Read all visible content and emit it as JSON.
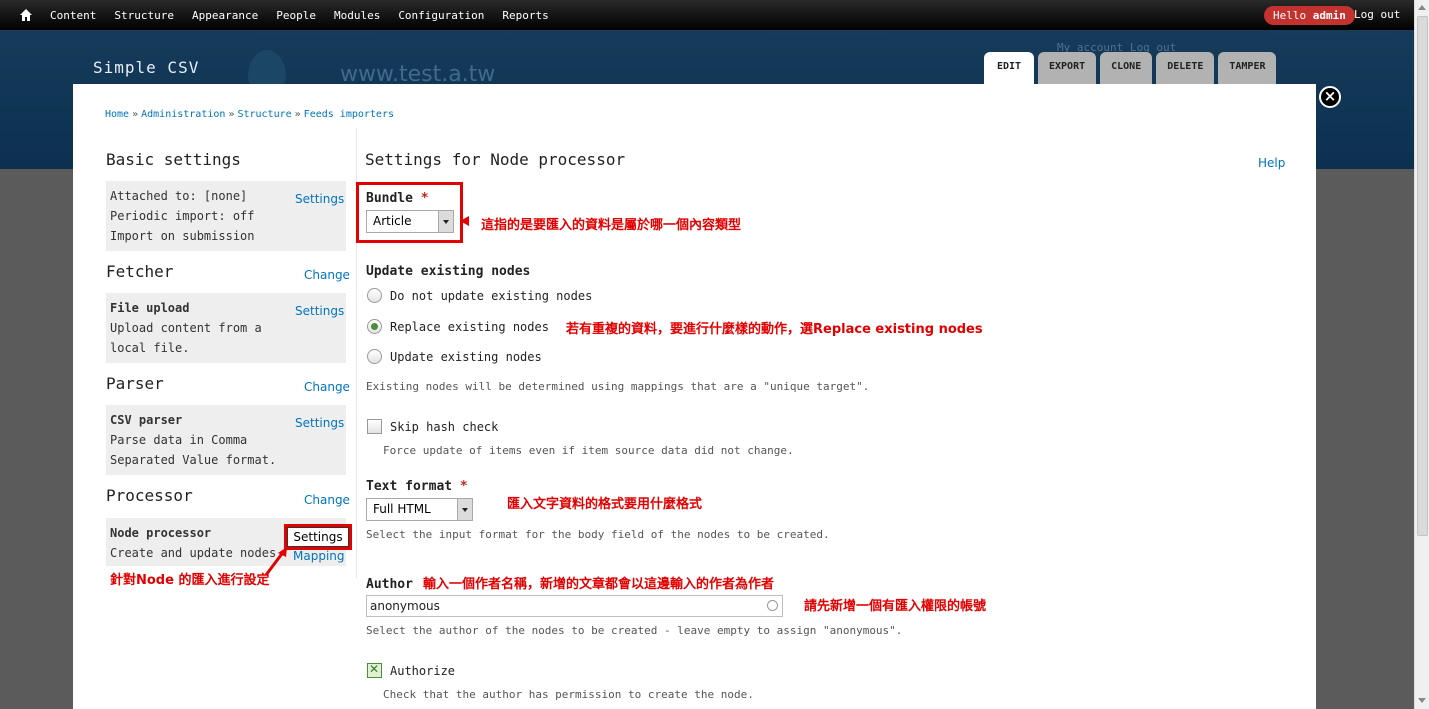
{
  "toolbar": {
    "items": [
      "Content",
      "Structure",
      "Appearance",
      "People",
      "Modules",
      "Configuration",
      "Reports"
    ],
    "hello_prefix": "Hello ",
    "hello_user": "admin",
    "logout": "Log out"
  },
  "header": {
    "site_name": "Simple CSV",
    "bg_url": "www.test.a.tw",
    "bg_links": "My account    Log out",
    "tabs": [
      "EDIT",
      "EXPORT",
      "CLONE",
      "DELETE",
      "TAMPER"
    ],
    "active_tab": "EDIT"
  },
  "breadcrumb": [
    "Home",
    "Administration",
    "Structure",
    "Feeds importers"
  ],
  "breadcrumb_sep": "»",
  "sidebar": {
    "basic": {
      "title": "Basic settings",
      "lines": [
        "Attached to: [none]",
        "Periodic import: off",
        "Import on submission"
      ],
      "link": "Settings"
    },
    "fetcher": {
      "title": "Fetcher",
      "change": "Change",
      "name": "File upload",
      "lines": [
        "Upload content from a",
        "local file."
      ],
      "link": "Settings"
    },
    "parser": {
      "title": "Parser",
      "change": "Change",
      "name": "CSV parser",
      "lines": [
        "Parse data in Comma",
        "Separated Value format."
      ],
      "link": "Settings"
    },
    "processor": {
      "title": "Processor",
      "change": "Change",
      "name": "Node processor",
      "lines": [
        "Create and update nodes."
      ],
      "link": "Settings",
      "link2": "Mapping"
    }
  },
  "main": {
    "title": "Settings for Node processor",
    "help": "Help",
    "bundle": {
      "label": "Bundle",
      "value": "Article"
    },
    "update": {
      "label": "Update existing nodes",
      "options": [
        "Do not update existing nodes",
        "Replace existing nodes",
        "Update existing nodes"
      ],
      "selected": "Replace existing nodes",
      "desc": "Existing nodes will be determined using mappings that are a \"unique target\"."
    },
    "skip_hash": {
      "label": "Skip hash check",
      "checked": false,
      "desc": "Force update of items even if item source data did not change."
    },
    "text_format": {
      "label": "Text format",
      "value": "Full HTML",
      "desc": "Select the input format for the body field of the nodes to be created."
    },
    "author": {
      "label": "Author",
      "value": "anonymous",
      "desc": "Select the author of the nodes to be created - leave empty to assign \"anonymous\"."
    },
    "authorize": {
      "label": "Authorize",
      "checked": true,
      "desc": "Check that the author has permission to create the node."
    },
    "required_mark": "*"
  },
  "annotations": {
    "bundle": "這指的是要匯入的資料是屬於哪一個內容類型",
    "replace": "若有重複的資料，要進行什麼樣的動作，選Replace existing nodes",
    "text_format": "匯入文字資料的格式要用什麼格式",
    "author": "輸入一個作者名稱，新增的文章都會以這邊輸入的作者為作者",
    "author_account": "請先新增一個有匯入權限的帳號",
    "processor": "針對Node 的匯入進行設定"
  },
  "colors": {
    "annotation": "#e20000",
    "link": "#0074bd",
    "header": "#0f3554"
  }
}
